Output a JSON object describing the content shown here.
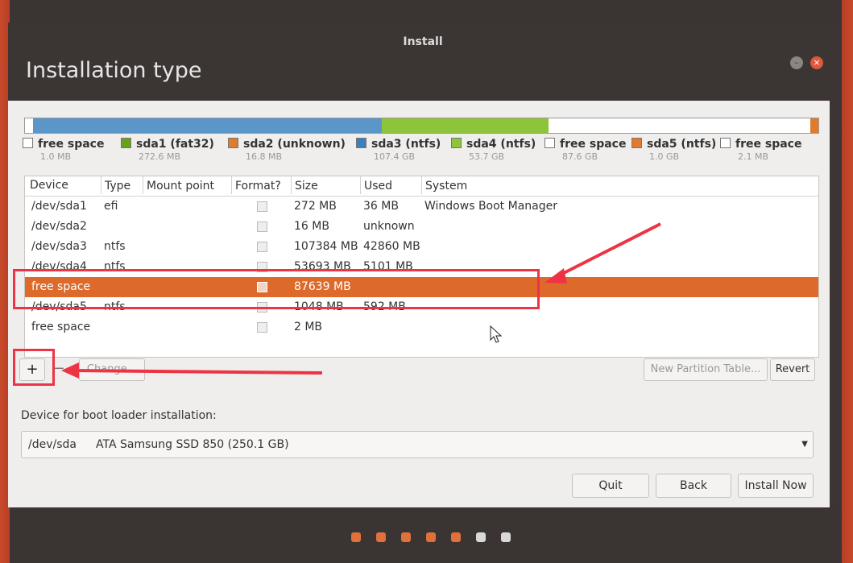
{
  "window": {
    "title": "Install"
  },
  "page": {
    "title": "Installation type"
  },
  "colors": {
    "free": "#ffffff",
    "fat32": "#6aa01a",
    "unknown": "#e07a2e",
    "ntfs_blue": "#3d7fbe",
    "ntfs_green": "#8ec43a",
    "highlight": "#ee3344",
    "selected_row": "#dd6a2a"
  },
  "bar_segments": [
    {
      "color": "#ffffff",
      "weight": 1
    },
    {
      "color": "#5c96c9",
      "weight": 44
    },
    {
      "color": "#8ec43a",
      "weight": 21
    },
    {
      "color": "#ffffff",
      "weight": 33
    },
    {
      "color": "#e07a2e",
      "weight": 1
    }
  ],
  "legend": [
    {
      "name": "free space",
      "size": "1.0 MB",
      "color": "#ffffff"
    },
    {
      "name": "sda1 (fat32)",
      "size": "272.6 MB",
      "color": "#6aa01a"
    },
    {
      "name": "sda2 (unknown)",
      "size": "16.8 MB",
      "color": "#e07a2e"
    },
    {
      "name": "sda3 (ntfs)",
      "size": "107.4 GB",
      "color": "#3d7fbe"
    },
    {
      "name": "sda4 (ntfs)",
      "size": "53.7 GB",
      "color": "#8ec43a"
    },
    {
      "name": "free space",
      "size": "87.6 GB",
      "color": "#ffffff"
    },
    {
      "name": "sda5 (ntfs)",
      "size": "1.0 GB",
      "color": "#e07a2e"
    },
    {
      "name": "free space",
      "size": "2.1 MB",
      "color": "#ffffff"
    }
  ],
  "table": {
    "headers": {
      "device": "Device",
      "type": "Type",
      "mount": "Mount point",
      "format": "Format?",
      "size": "Size",
      "used": "Used",
      "system": "System"
    },
    "rows": [
      {
        "device": "/dev/sda1",
        "type": "efi",
        "size": "272 MB",
        "used": "36 MB",
        "system": "Windows Boot Manager"
      },
      {
        "device": "/dev/sda2",
        "type": "",
        "size": "16 MB",
        "used": "unknown",
        "system": ""
      },
      {
        "device": "/dev/sda3",
        "type": "ntfs",
        "size": "107384 MB",
        "used": "42860 MB",
        "system": ""
      },
      {
        "device": "/dev/sda4",
        "type": "ntfs",
        "size": "53693 MB",
        "used": "5101 MB",
        "system": ""
      },
      {
        "device": "free space",
        "type": "",
        "size": "87639 MB",
        "used": "",
        "system": ""
      },
      {
        "device": "/dev/sda5",
        "type": "ntfs",
        "size": "1048 MB",
        "used": "592 MB",
        "system": ""
      },
      {
        "device": "free space",
        "type": "",
        "size": "2 MB",
        "used": "",
        "system": ""
      }
    ],
    "selected_index": 4
  },
  "toolbar": {
    "add": "+",
    "remove": "−",
    "change": "Change...",
    "new_table": "New Partition Table...",
    "revert": "Revert"
  },
  "boot": {
    "label": "Device for boot loader installation:",
    "device": "/dev/sda",
    "desc": "ATA Samsung SSD 850 (250.1 GB)"
  },
  "buttons": {
    "quit": "Quit",
    "back": "Back",
    "install": "Install Now"
  },
  "progress_dots": [
    {
      "color": "#e2703a"
    },
    {
      "color": "#e2703a"
    },
    {
      "color": "#e2703a"
    },
    {
      "color": "#e2703a"
    },
    {
      "color": "#e2703a"
    },
    {
      "color": "#d8d8d8"
    },
    {
      "color": "#d8d8d8"
    }
  ]
}
